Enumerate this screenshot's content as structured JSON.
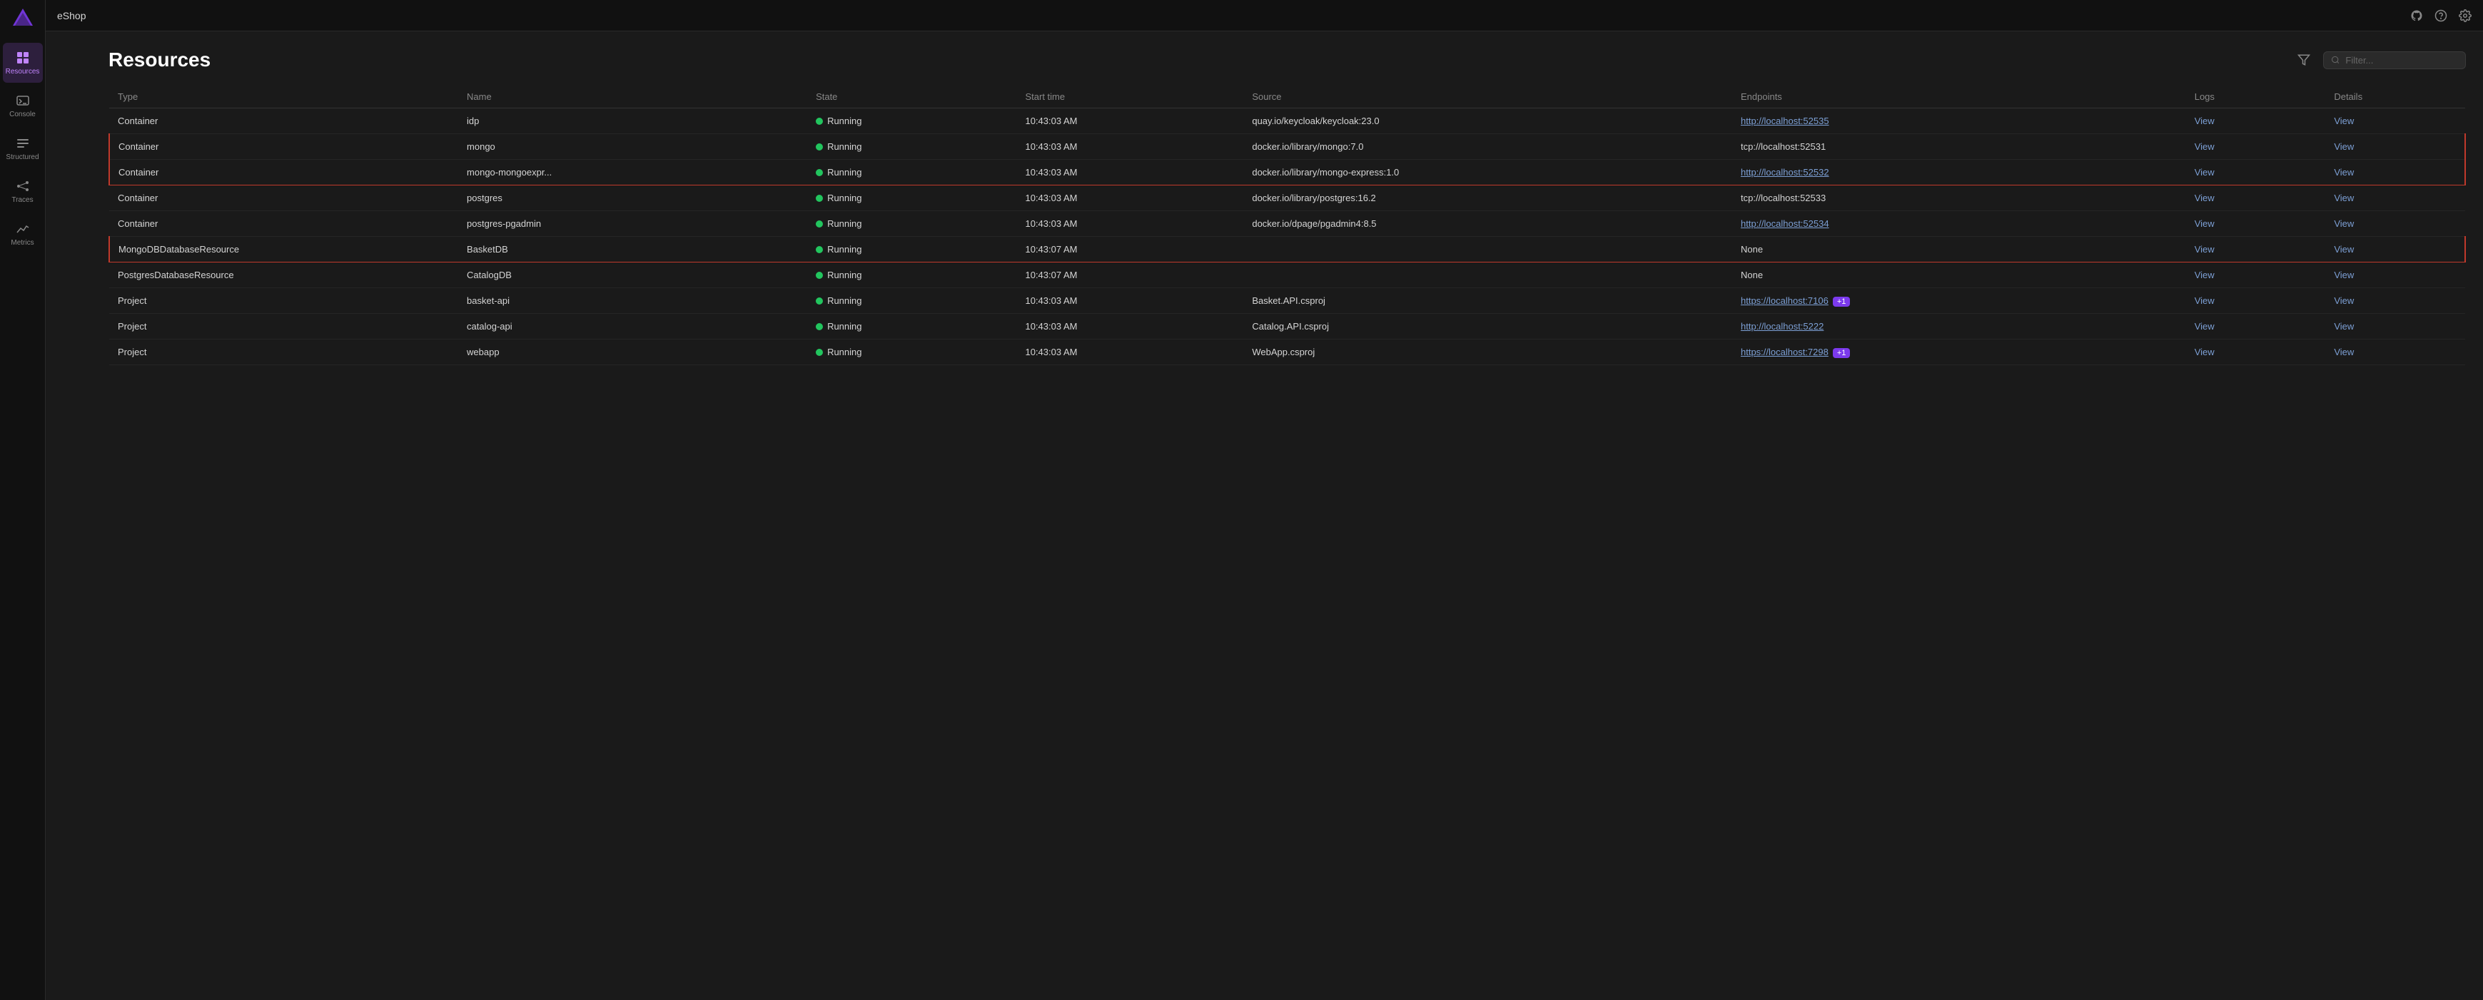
{
  "app": {
    "title": "eShop"
  },
  "sidebar": {
    "items": [
      {
        "label": "Resources",
        "icon": "grid",
        "active": true
      },
      {
        "label": "Console",
        "icon": "console",
        "active": false
      },
      {
        "label": "Structured",
        "icon": "structured",
        "active": false
      },
      {
        "label": "Traces",
        "icon": "traces",
        "active": false
      },
      {
        "label": "Metrics",
        "icon": "metrics",
        "active": false
      }
    ]
  },
  "page": {
    "title": "Resources",
    "filter_placeholder": "Filter..."
  },
  "table": {
    "columns": [
      "Type",
      "Name",
      "State",
      "Start time",
      "Source",
      "Endpoints",
      "Logs",
      "Details"
    ],
    "rows": [
      {
        "type": "Container",
        "name": "idp",
        "state": "Running",
        "start_time": "10:43:03 AM",
        "source": "quay.io/keycloak/keycloak:23.0",
        "endpoints": "http://localhost:52535",
        "endpoint_link": true,
        "endpoint_plus": false,
        "logs": "View",
        "details": "View",
        "highlight_group": "",
        "endpoint_text_only": false
      },
      {
        "type": "Container",
        "name": "mongo",
        "state": "Running",
        "start_time": "10:43:03 AM",
        "source": "docker.io/library/mongo:7.0",
        "endpoints": "tcp://localhost:52531",
        "endpoint_link": false,
        "endpoint_plus": false,
        "logs": "View",
        "details": "View",
        "highlight_group": "ab-top",
        "endpoint_text_only": true
      },
      {
        "type": "Container",
        "name": "mongo-mongoexpr...",
        "state": "Running",
        "start_time": "10:43:03 AM",
        "source": "docker.io/library/mongo-express:1.0",
        "endpoints": "http://localhost:52532",
        "endpoint_link": true,
        "endpoint_plus": false,
        "logs": "View",
        "details": "View",
        "highlight_group": "ab-bottom",
        "endpoint_text_only": false
      },
      {
        "type": "Container",
        "name": "postgres",
        "state": "Running",
        "start_time": "10:43:03 AM",
        "source": "docker.io/library/postgres:16.2",
        "endpoints": "tcp://localhost:52533",
        "endpoint_link": false,
        "endpoint_plus": false,
        "logs": "View",
        "details": "View",
        "highlight_group": "",
        "endpoint_text_only": true
      },
      {
        "type": "Container",
        "name": "postgres-pgadmin",
        "state": "Running",
        "start_time": "10:43:03 AM",
        "source": "docker.io/dpage/pgadmin4:8.5",
        "endpoints": "http://localhost:52534",
        "endpoint_link": true,
        "endpoint_plus": false,
        "logs": "View",
        "details": "View",
        "highlight_group": "",
        "endpoint_text_only": false
      },
      {
        "type": "MongoDBDatabaseResource",
        "name": "BasketDB",
        "state": "Running",
        "start_time": "10:43:07 AM",
        "source": "",
        "endpoints": "None",
        "endpoint_link": false,
        "endpoint_plus": false,
        "logs": "View",
        "details": "View",
        "highlight_group": "single",
        "endpoint_text_only": true
      },
      {
        "type": "PostgresDatabaseResource",
        "name": "CatalogDB",
        "state": "Running",
        "start_time": "10:43:07 AM",
        "source": "",
        "endpoints": "None",
        "endpoint_link": false,
        "endpoint_plus": false,
        "logs": "View",
        "details": "View",
        "highlight_group": "",
        "endpoint_text_only": true
      },
      {
        "type": "Project",
        "name": "basket-api",
        "state": "Running",
        "start_time": "10:43:03 AM",
        "source": "Basket.API.csproj",
        "endpoints": "https://localhost:7106,",
        "endpoint_link": true,
        "endpoint_plus": true,
        "endpoint_plus_label": "+1",
        "logs": "View",
        "details": "View",
        "highlight_group": "",
        "endpoint_text_only": false
      },
      {
        "type": "Project",
        "name": "catalog-api",
        "state": "Running",
        "start_time": "10:43:03 AM",
        "source": "Catalog.API.csproj",
        "endpoints": "http://localhost:5222",
        "endpoint_link": true,
        "endpoint_plus": false,
        "logs": "View",
        "details": "View",
        "highlight_group": "",
        "endpoint_text_only": false
      },
      {
        "type": "Project",
        "name": "webapp",
        "state": "Running",
        "start_time": "10:43:03 AM",
        "source": "WebApp.csproj",
        "endpoints": "https://localhost:7298,",
        "endpoint_link": true,
        "endpoint_plus": true,
        "endpoint_plus_label": "+1",
        "logs": "View",
        "details": "View",
        "highlight_group": "",
        "endpoint_text_only": false
      }
    ]
  }
}
